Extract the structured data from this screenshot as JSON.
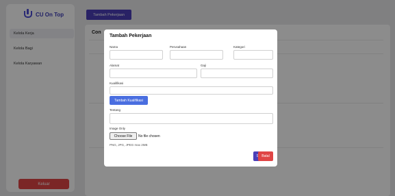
{
  "sidebar": {
    "logo": "CU On Top",
    "items": [
      {
        "label": "Kelola Kerja",
        "active": true
      },
      {
        "label": "Kelola Bagi",
        "active": false
      },
      {
        "label": "Kelola Karyawan",
        "active": false
      }
    ],
    "logout": "Keluar"
  },
  "main": {
    "add_job_button": "Tambah Pekerjaan",
    "card_title": "Con"
  },
  "modal": {
    "title": "Tambah Pekerjaan",
    "fields": {
      "nama": "Nama",
      "perusahaan": "Perusahaan",
      "kategori": "Kategori",
      "alamat": "Alamat",
      "gaji": "Gaji",
      "kualifikasi": "Kualifikasi",
      "tentang": "Tentang",
      "image": "Image Only"
    },
    "add_qualification": "Tambah Kualifikasi",
    "file_button": "Choose File",
    "file_status": "No file chosen",
    "hint": "PNG, JPG, JPEG max 2MB",
    "save": "Simpan",
    "cancel": "Batal"
  },
  "colors": {
    "primary": "#4b3fb8",
    "blue": "#4a6ee0",
    "danger": "#e04545"
  }
}
